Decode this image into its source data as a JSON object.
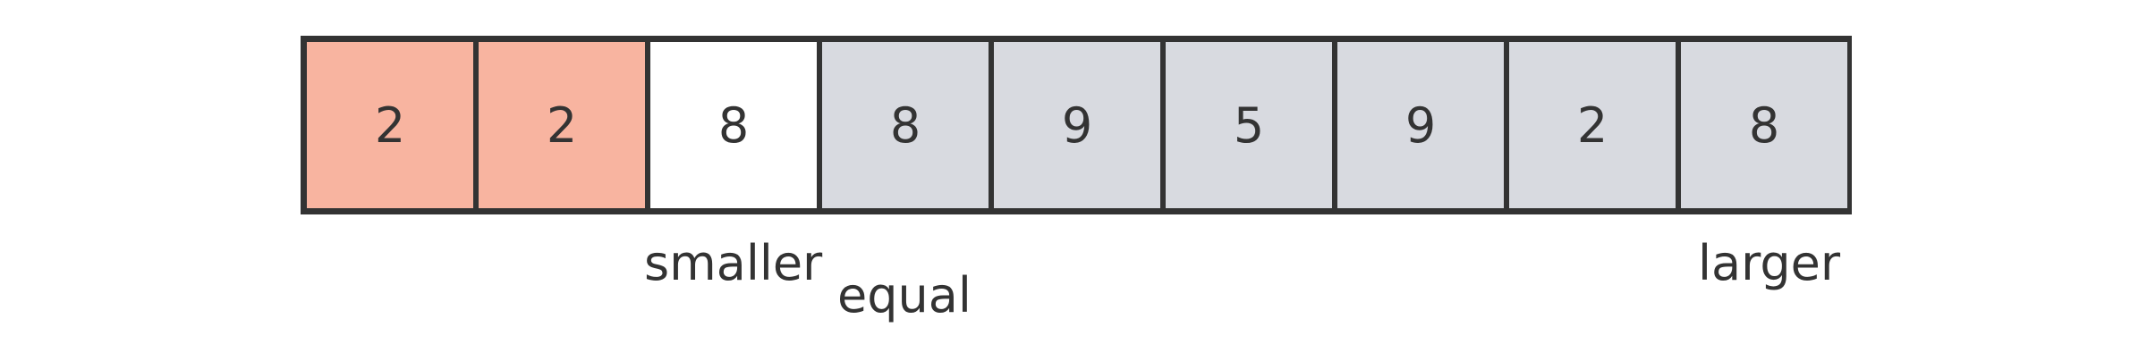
{
  "array": {
    "cells": [
      {
        "value": "2",
        "color": "#f8b4a0"
      },
      {
        "value": "2",
        "color": "#f8b4a0"
      },
      {
        "value": "8",
        "color": "#ffffff"
      },
      {
        "value": "8",
        "color": "#d8dae0"
      },
      {
        "value": "9",
        "color": "#d8dae0"
      },
      {
        "value": "5",
        "color": "#d8dae0"
      },
      {
        "value": "9",
        "color": "#d8dae0"
      },
      {
        "value": "2",
        "color": "#d8dae0"
      },
      {
        "value": "8",
        "color": "#d8dae0"
      }
    ]
  },
  "pointers": {
    "smaller": "smaller",
    "equal": "equal",
    "larger": "larger"
  },
  "colors": {
    "border": "#333333",
    "smaller_region": "#f8b4a0",
    "current": "#ffffff",
    "unprocessed": "#d8dae0"
  }
}
